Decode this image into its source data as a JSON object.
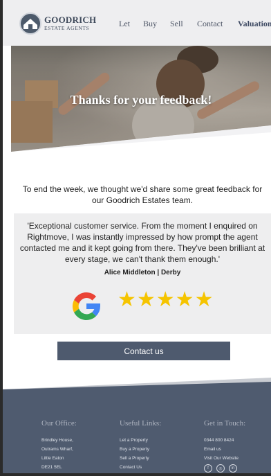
{
  "brand": {
    "name": "GOODRICH",
    "tagline": "ESTATE AGENTS"
  },
  "nav": {
    "items": [
      "Let",
      "Buy",
      "Sell",
      "Contact",
      "Valuation"
    ]
  },
  "hero": {
    "title": "Thanks for your feedback!"
  },
  "intro": {
    "text": "To end the week, we thought we'd share some great feedback for our Goodrich Estates team."
  },
  "testimonial": {
    "quote": "'Exceptional customer service. From the moment I enquired on Rightmove, I was instantly impressed by how prompt the agent contacted me and it kept going from there. They've been brilliant at every stage, we can't thank them enough.'",
    "author": "Alice Middleton | Derby",
    "stars": "★★★★★",
    "rating": 5,
    "review_source_icon": "google-icon"
  },
  "cta": {
    "label": "Contact us"
  },
  "footer": {
    "office_title": "Our Office:",
    "office_lines": [
      "Brindley House,",
      "Outrams Wharf,",
      "Little Eaton",
      "DE21 5EL"
    ],
    "links_title": "Useful Links:",
    "links": [
      "Let a Property",
      "Buy a Property",
      "Sell a Property",
      "Contact Us"
    ],
    "contact_title": "Get in Touch:",
    "contact_lines": [
      "0344 800 8424",
      "Email us",
      "Visit Our Website"
    ],
    "social_icons": [
      "facebook-icon",
      "instagram-icon",
      "linkedin-icon"
    ],
    "social_glyphs": [
      "f",
      "◎",
      "in"
    ]
  },
  "colors": {
    "brand_dark": "#4e5a6e",
    "header_bg": "#eeeef0",
    "star": "#f5c400",
    "footer_bg": "#4f5b6f"
  }
}
